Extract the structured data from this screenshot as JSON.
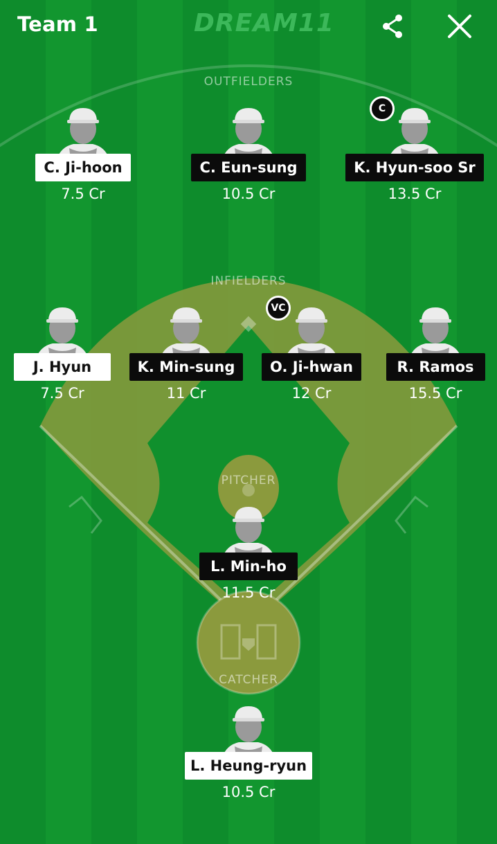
{
  "header": {
    "team_title": "Team 1",
    "logo_text": "DREAM11"
  },
  "sections": {
    "outfielders": "OUTFIELDERS",
    "infielders": "INFIELDERS",
    "pitcher": "PITCHER",
    "catcher": "CATCHER"
  },
  "roles": {
    "captain": "C",
    "vice_captain": "VC"
  },
  "players": {
    "of1": {
      "name": "C. Ji-hoon",
      "credits": "7.5 Cr"
    },
    "of2": {
      "name": "C. Eun-sung",
      "credits": "10.5 Cr"
    },
    "of3": {
      "name": "K. Hyun-soo Sr",
      "credits": "13.5 Cr"
    },
    "if1": {
      "name": "J. Hyun",
      "credits": "7.5 Cr"
    },
    "if2": {
      "name": "K. Min-sung",
      "credits": "11 Cr"
    },
    "if3": {
      "name": "O. Ji-hwan",
      "credits": "12 Cr"
    },
    "if4": {
      "name": "R. Ramos",
      "credits": "15.5 Cr"
    },
    "p1": {
      "name": "L. Min-ho",
      "credits": "11.5 Cr"
    },
    "c1": {
      "name": "L. Heung-ryun",
      "credits": "10.5 Cr"
    }
  },
  "colors": {
    "field_green": "#0e8c2c",
    "stripe_green": "#12962f",
    "infield_dirt": "#8a9a3a",
    "badge_dark": "#0b0b0b",
    "badge_light": "#ffffff"
  },
  "icons": {
    "share": "share-icon",
    "close": "close-icon",
    "avatar": "player-avatar-icon"
  }
}
